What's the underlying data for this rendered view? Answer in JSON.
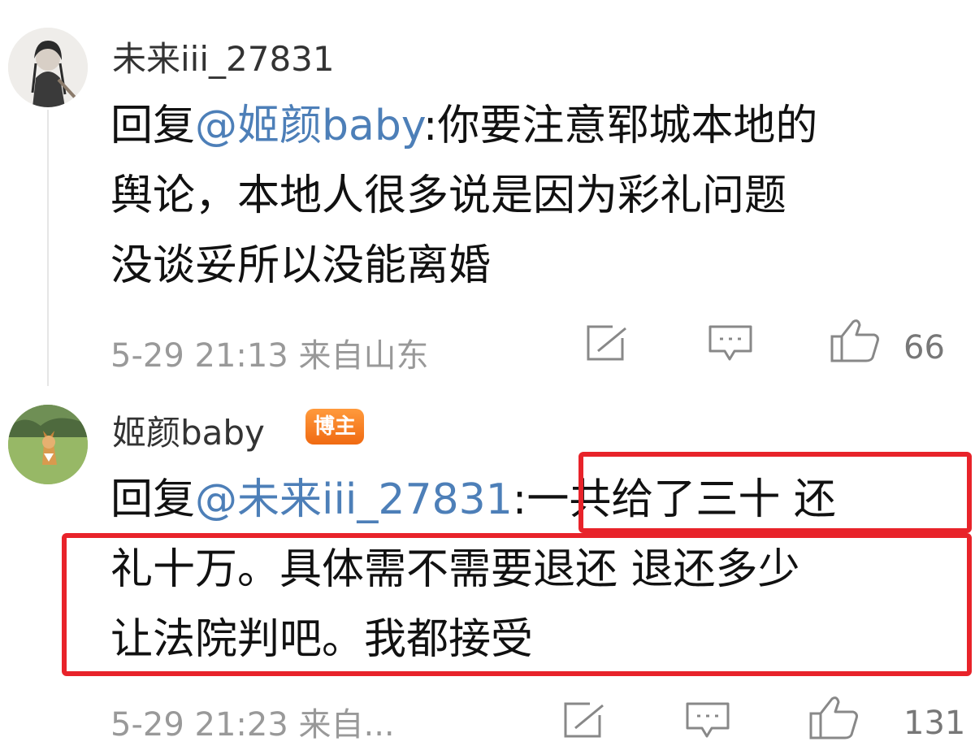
{
  "comment1": {
    "username": "未来iii_27831",
    "reply_prefix": "回复",
    "mention": "@姬颜baby",
    "colon": ":",
    "lines": [
      "你要注意郓城本地的",
      "舆论，本地人很多说是因为彩礼问题",
      "没谈妥所以没能离婚"
    ],
    "meta": "5-29 21:13 来自山东",
    "like_count": "66"
  },
  "comment2": {
    "username": "姬颜baby",
    "badge": "博主",
    "reply_prefix": "回复",
    "mention": "@未来iii_27831",
    "colon": ":",
    "lines": [
      "一共给了三十 还",
      "礼十万。具体需不需要退还 退还多少",
      "让法院判吧。我都接受"
    ],
    "meta": "5-29 21:23 来自...",
    "like_count": "131"
  },
  "colors": {
    "mention": "#4d7fb8",
    "highlight": "#e8232a",
    "badge": "#f07a1a"
  }
}
